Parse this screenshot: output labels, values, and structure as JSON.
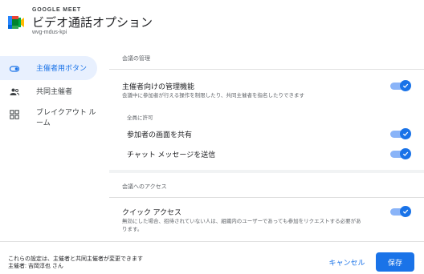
{
  "header": {
    "brand": "GOOGLE MEET",
    "title": "ビデオ通話オプション",
    "meeting_code": "wvg-mdus-kpi"
  },
  "sidebar": {
    "items": [
      {
        "label": "主催者用ボタン",
        "icon": "toggle-icon",
        "active": true
      },
      {
        "label": "共同主催者",
        "icon": "people-icon",
        "active": false
      },
      {
        "label": "ブレイクアウト ルーム",
        "icon": "breakout-rooms-icon",
        "active": false
      }
    ]
  },
  "meeting_management": {
    "heading": "会議の管理",
    "host_controls": {
      "title": "主催者向けの管理機能",
      "description": "会議中に参加者が行える操作を制限したり、共同主催者を指名したりできます",
      "enabled": true
    },
    "allow_label": "全員に許可",
    "share_screen": {
      "label": "参加者の画面を共有",
      "enabled": true
    },
    "chat": {
      "label": "チャット メッセージを送信",
      "enabled": true
    }
  },
  "meeting_access": {
    "heading": "会議へのアクセス",
    "quick_access": {
      "title": "クイック アクセス",
      "description": "無効にした場合、招待されていない人は、組織内のユーザーであっても参加をリクエストする必要があります。",
      "enabled": true
    }
  },
  "footer": {
    "note": "これらの設定は、主催者と共同主催者が変更できます",
    "host": "主催者: 吉岡淳也 さん",
    "cancel_label": "キャンセル",
    "save_label": "保存"
  },
  "colors": {
    "accent": "#1a73e8",
    "active_nav_bg": "#e8f0fe",
    "toggle_track": "#8ab4f8",
    "content_bg": "#f1f3f4"
  }
}
